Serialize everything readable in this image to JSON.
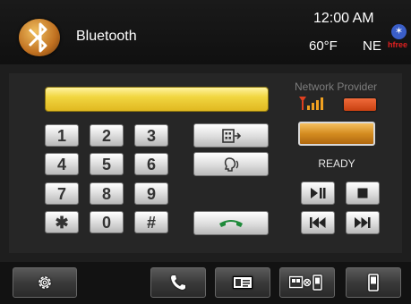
{
  "header": {
    "title": "Bluetooth",
    "time": "12:00 AM",
    "temperature": "60°F",
    "heading": "NE",
    "bt_status_text": "hfree"
  },
  "dialer": {
    "number_value": "",
    "keys": [
      "1",
      "2",
      "3",
      "4",
      "5",
      "6",
      "7",
      "8",
      "9",
      "✱",
      "0",
      "#"
    ]
  },
  "network": {
    "label": "Network Provider",
    "operator_value": "",
    "status": "READY"
  },
  "icons": {
    "logo": "app-logo-icon",
    "bluetooth": "bluetooth-icon",
    "phonebook": "phonebook-icon",
    "voice_dial": "voice-dial-icon",
    "call": "call-icon",
    "play_pause": "play-pause-icon",
    "stop": "stop-icon",
    "previous": "previous-track-icon",
    "next": "next-track-icon",
    "settings": "gear-icon",
    "dial_tab": "dial-phone-icon",
    "contacts": "contact-card-icon",
    "pairing": "device-pairing-icon",
    "mobile": "mobile-phone-icon"
  },
  "colors": {
    "display_yellow": "#f1d640",
    "operator_orange": "#d48c20",
    "call_green": "#1e8a3a",
    "signal_red": "#e04020",
    "bt_blue": "#3a5ec8"
  }
}
